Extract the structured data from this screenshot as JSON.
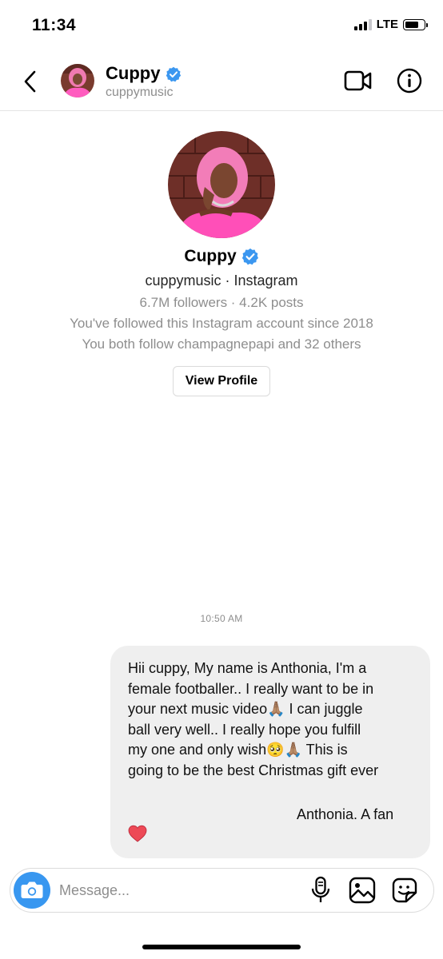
{
  "status_bar": {
    "time": "11:34",
    "network": "LTE"
  },
  "header": {
    "name": "Cuppy",
    "username": "cuppymusic"
  },
  "profile": {
    "name": "Cuppy",
    "subtitle": "cuppymusic · Instagram",
    "stats": "6.7M followers · 4.2K posts",
    "followed_since": "You've followed this Instagram account since 2018",
    "mutual": "You both follow champagnepapi and 32 others",
    "view_profile_label": "View Profile"
  },
  "conversation": {
    "timestamp": "10:50 AM",
    "message": {
      "lines": [
        "Hii cuppy, My name is Anthonia, I'm a",
        "female footballer.. I really want to be in",
        "your next music video🙏🏽  I can juggle",
        "ball very well.. I really hope you fulfill",
        "my one and only wish🥺🙏🏽   This is",
        "going to be the best Christmas gift ever"
      ],
      "signature": "Anthonia. A fan",
      "emoji": "heart"
    }
  },
  "composer": {
    "placeholder": "Message..."
  },
  "icons": {
    "back": "chevron-left-icon",
    "verified": "verified-badge-icon",
    "video_call": "video-camera-icon",
    "info": "info-icon",
    "camera": "camera-icon",
    "mic": "microphone-icon",
    "gallery": "image-gallery-icon",
    "sticker": "sticker-icon"
  },
  "colors": {
    "accent_blue": "#3897f0",
    "verified_blue": "#3b97f0",
    "bubble": "#efefef",
    "heart": "#ed4956"
  }
}
